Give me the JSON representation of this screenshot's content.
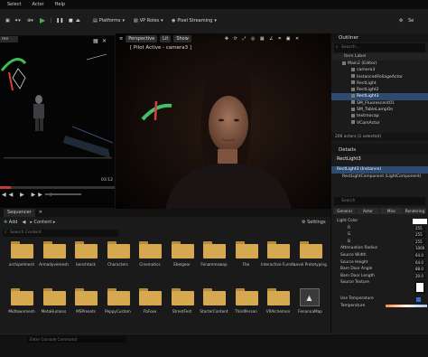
{
  "menu": {
    "items": [
      "Select",
      "Actor",
      "Help"
    ]
  },
  "toolbar": {
    "platforms": "Platforms",
    "vp_roles": "VP Roles",
    "pixel_streaming": "Pixel Streaming"
  },
  "left_viewport": {
    "tag": "me",
    "time": "03:12"
  },
  "viewport": {
    "perspective": "Perspective",
    "lit": "Lit",
    "show": "Show",
    "pilot_label": "[ Pilot Active - camera3 ]"
  },
  "outliner": {
    "title": "Outliner",
    "search_placeholder": "Search...",
    "column": "Item Label",
    "rows": [
      "Main2 (Editor)",
      "camera3",
      "InstancedFoliageActor",
      "RectLight",
      "RectLight2",
      "RectLight3",
      "SM_Fluorescent01",
      "SM_TableLampOn",
      "textmocap",
      "VCamActor"
    ],
    "footer": "206 actors (1 selected)"
  },
  "details": {
    "title": "Details",
    "object": "RectLight3",
    "instance": "RectLight3 (Instance)",
    "component": "RectLightComponent (LightComponent)",
    "search_placeholder": "Search",
    "tabs": [
      "General",
      "Actor",
      "Misc",
      "Rendering"
    ],
    "props": [
      {
        "label": "Light Color",
        "value": ""
      },
      {
        "label": "R",
        "value": "255"
      },
      {
        "label": "G",
        "value": "255"
      },
      {
        "label": "B",
        "value": "255"
      },
      {
        "label": "Attenuation Radius",
        "value": "1000"
      },
      {
        "label": "Source Width",
        "value": "64.0"
      },
      {
        "label": "Source Height",
        "value": "64.0"
      },
      {
        "label": "Barn Door Angle",
        "value": "88.0"
      },
      {
        "label": "Barn Door Length",
        "value": "20.0"
      },
      {
        "label": "Source Texture",
        "value": ""
      },
      {
        "label": "Use Temperature",
        "value": ""
      },
      {
        "label": "Temperature",
        "value": ""
      }
    ]
  },
  "content": {
    "sequencer_tab": "Sequencer",
    "add_label": "Add",
    "breadcrumb": "Content",
    "search_placeholder": "Search Content",
    "settings_label": "Settings",
    "row1": [
      "archipelmesh",
      "Armadyvemesh",
      "benchtack",
      "Characters",
      "Cinematics",
      "Ebelgear",
      "Fenammowap",
      "Fbe",
      "Interactive Furniture",
      "Level Prototyping"
    ],
    "row2": [
      "Midtownmesh",
      "MetaHumans",
      "MSPresets",
      "PeppyCustom",
      "FbFoxe",
      "StreetFest",
      "StarterContent",
      "ThirdPerson",
      "VRAlchemon",
      "FenannaMap"
    ]
  },
  "console": {
    "placeholder": "Enter Console Command"
  },
  "colors": {
    "accent_blue": "#2d4b6e",
    "folder": "#d6a84f",
    "play_green": "#4caf50"
  }
}
